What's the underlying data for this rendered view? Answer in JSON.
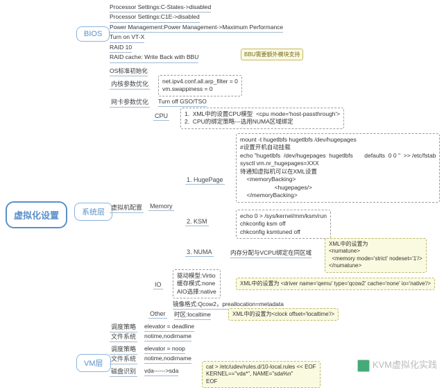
{
  "root": "虚拟化设置",
  "bios": {
    "label": "BIOS",
    "items": [
      "Processor Settings:C-States->disabled",
      "Processor Settings:C1E->disabled",
      "Power Management:Power Management->Maximum Performance",
      "Turn on  VT-X",
      "RAID 10",
      "RAID cache: Write Back with BBU"
    ],
    "tag": "BBU需要额外模块支持"
  },
  "sys": {
    "label": "系统层",
    "os": "OS标准初始化",
    "kernel": {
      "label": "内核参数优化",
      "box": "net.ipv4.conf.all.arp_filter = 0\nvm.swappiness = 0"
    },
    "nic": {
      "label": "网卡参数优化",
      "val": "Turn  off  GSO/TSO"
    },
    "vmcfg": {
      "label": "虚拟机配置"
    },
    "cpu": {
      "label": "CPU",
      "box": "1.  XML中的设置CPU模型  <cpu mode='host-passthrough'>\n2.  CPU的绑定策略---选用NUMA区域绑定"
    },
    "mem": {
      "label": "Memory"
    },
    "hugepage": {
      "label": "1.   HugePage",
      "box": "mount -t hugetlbfs hugetlbfs /dev/hugepages\n#设置开机自动挂载\necho \"hugetlbfs  /dev/hugepages  hugetlbfs       defaults  0 0 \"  >> /etc/fstab\nsysctl vm.nr_hugepages=XXX\n待通知虚拟机可以在XML设置\n    <memoryBacking>\n                     <hugepages/>\n    </memoryBacking>"
    },
    "ksm": {
      "label": "2.   KSM",
      "box": "echo 0 > /sys/kernel/mm/ksm/run\nchkconfig ksm off\nchkconfig ksmtuned off"
    },
    "numa": {
      "label": "3.   NUMA",
      "val": "内存分配与VCPU绑定在同区域",
      "box": "XML中的设置为\n<numatune>\n  <memory mode='strict' nodeset='1'/>\n</numatune>"
    },
    "io": {
      "label": "IO",
      "box": "驱动模型:Virtio\n缓存模式:none\nAIO选择:native",
      "xml": "XML中的设置为   <driver name='qemu' type='qcow2' cache='none' io='native'/>",
      "img": "镜像格式:Qcow2，preallocation=metadata"
    },
    "other": {
      "label": "Other",
      "val": "时区:localtime",
      "xml": "XML中的设置为<clock offset='localtime'/>"
    },
    "sched": {
      "label": "调度策略",
      "val": "elevator = deadline"
    },
    "fs": {
      "label": "文件系统",
      "val": "notime,nodirname"
    }
  },
  "vm": {
    "label": "VM层",
    "sched": {
      "label": "调度策略",
      "val": "elevator = noop"
    },
    "fs": {
      "label": "文件系统",
      "val": "notime,nodirname"
    },
    "disk": {
      "label": "磁盘识别",
      "val": "vda------>sda",
      "box": "cat > /etc/udev/rules.d/10-local.rules << EOF\nKERNEL==\"vda*\", NAME=\"sda%n\"\nEOF"
    }
  },
  "watermark": "KVM虚拟化实践"
}
